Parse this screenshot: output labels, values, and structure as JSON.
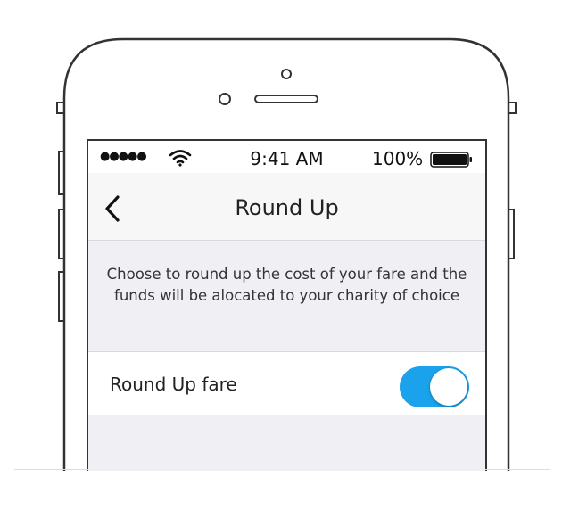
{
  "status_bar": {
    "signal": "●●●●●",
    "time": "9:41 AM",
    "battery_percent": "100%",
    "icons": [
      "wifi-icon",
      "battery-icon"
    ]
  },
  "nav": {
    "back_icon": "chevron-left-icon",
    "title": "Round Up"
  },
  "description": "Choose to round up the cost of your fare and the funds will be alocated to your charity of choice",
  "setting": {
    "label": "Round Up fare",
    "enabled": true
  },
  "colors": {
    "accent": "#1aa3ec",
    "background": "#f0eff4",
    "nav_background": "#f7f7f7",
    "phone_outline": "#333333"
  }
}
